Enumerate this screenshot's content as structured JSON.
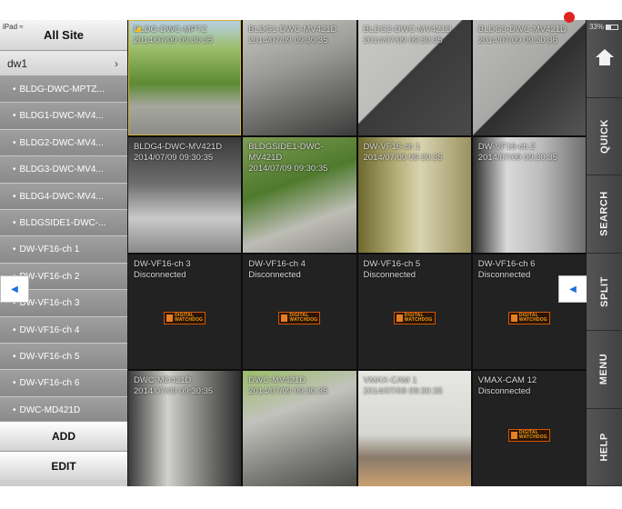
{
  "status": {
    "device": "iPad",
    "battery": "33%"
  },
  "sidebar": {
    "title": "All Site",
    "group": "dw1",
    "cameras": [
      "BLDG-DWC-MPTZ...",
      "BLDG1-DWC-MV4...",
      "BLDG2-DWC-MV4...",
      "BLDG3-DWC-MV4...",
      "BLDG4-DWC-MV4...",
      "BLDGSIDE1-DWC-...",
      "DW-VF16-ch 1",
      "DW-VF16-ch 2",
      "DW-VF16-ch 3",
      "DW-VF16-ch 4",
      "DW-VF16-ch 5",
      "DW-VF16-ch 6",
      "DWC-MD421D"
    ],
    "add_label": "ADD",
    "edit_label": "EDIT"
  },
  "tiles": [
    {
      "name": "BLDG-DWC-MPTZ",
      "time": "2014/07/09 09:30:35",
      "scene": "tree"
    },
    {
      "name": "BLDG1-DWC-MV421D",
      "time": "2014/07/09 09:30:35",
      "scene": "lot"
    },
    {
      "name": "BLDG2-DWC-MV421D",
      "time": "2014/07/09 09:30:35",
      "scene": "shadow"
    },
    {
      "name": "BLDG3-DWC-MV421D",
      "time": "2014/07/09 09:30:36",
      "scene": "car"
    },
    {
      "name": "BLDG4-DWC-MV421D",
      "time": "2014/07/09 09:30:35",
      "scene": "roof"
    },
    {
      "name": "BLDGSIDE1-DWC-MV421D",
      "time": "2014/07/09 09:30:35",
      "scene": "garden"
    },
    {
      "name": "DW-VF16-ch 1",
      "time": "2014/07/09 09:30:35",
      "scene": "hall"
    },
    {
      "name": "DW-VF16-ch 2",
      "time": "2014/07/09 09:30:35",
      "scene": "office"
    },
    {
      "name": "DW-VF16-ch 3",
      "status": "Disconnected"
    },
    {
      "name": "DW-VF16-ch 4",
      "status": "Disconnected"
    },
    {
      "name": "DW-VF16-ch 5",
      "status": "Disconnected"
    },
    {
      "name": "DW-VF16-ch 6",
      "status": "Disconnected"
    },
    {
      "name": "DWC-MD421D",
      "time": "2014/07/09 09:30:35",
      "scene": "ware"
    },
    {
      "name": "DWC-MV421D",
      "time": "2014/07/09 09:30:35",
      "scene": "road"
    },
    {
      "name": "VMAX-CAM 1",
      "time": "2014/07/09 09:30:35",
      "scene": "people"
    },
    {
      "name": "VMAX-CAM 12",
      "status": "Disconnected"
    }
  ],
  "logo": {
    "line1": "DIGITAL",
    "line2": "WATCHDOG"
  },
  "toolbar": {
    "home_icon": "home-icon",
    "items": [
      "QUICK",
      "SEARCH",
      "SPLIT",
      "MENU",
      "HELP"
    ]
  },
  "colors": {
    "record": "#e02424",
    "selected_border": "#d0b23a",
    "arrow": "#1e6fd9"
  }
}
